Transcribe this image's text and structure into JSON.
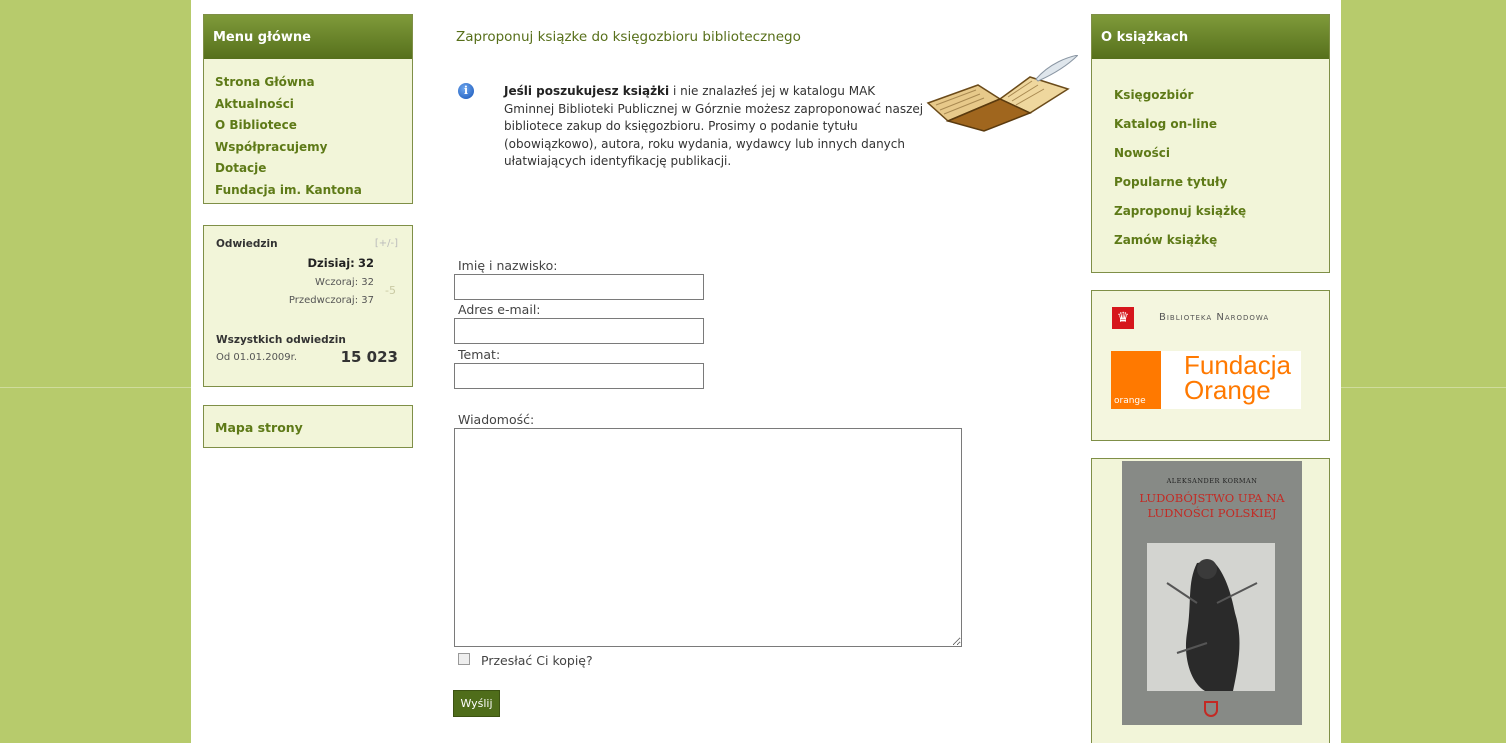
{
  "left": {
    "menu": {
      "title": "Menu główne",
      "items": [
        "Strona Główna",
        "Aktualności",
        "O Bibliotece",
        "Współpracujemy",
        "Dotacje",
        "Fundacja im. Kantona"
      ]
    },
    "stats": {
      "title": "Odwiedzin",
      "toggle": "[+/-]",
      "today_label": "Dzisiaj:",
      "today": "32",
      "yesterday_label": "Wczoraj:",
      "yesterday": "32",
      "before_label": "Przedwczoraj:",
      "before": "37",
      "diff": "-5",
      "total_title": "Wszystkich odwiedzin",
      "since": "Od 01.01.2009r.",
      "total": "15 023"
    },
    "sitemap": "Mapa strony"
  },
  "main": {
    "title": "Zaproponuj ksiązke do księgozbioru bibliotecznego",
    "info_bold": "Jeśli poszukujesz książki",
    "info_rest": " i nie znalazłeś jej w katalogu MAK Gminnej Biblioteki Publicznej w Górznie możesz zaproponować naszej bibliotece zakup do księgozbioru. Prosimy o podanie tytułu (obowiązkowo), autora, roku wydania, wydawcy lub innych danych ułatwiających identyfikację publikacji.",
    "form": {
      "name_label": "Imię i nazwisko:",
      "email_label": "Adres e-mail:",
      "subject_label": "Temat:",
      "message_label": "Wiadomość:",
      "copy_label": "Przesłać Ci kopię?",
      "send_label": "Wyślij",
      "name_value": "",
      "email_value": "",
      "subject_value": ""
    }
  },
  "right": {
    "about": {
      "title": "O książkach",
      "items": [
        "Księgozbiór",
        "Katalog on-line",
        "Nowości",
        "Popularne tytuły",
        "Zaproponuj książkę",
        "Zamów książkę"
      ]
    },
    "logos": {
      "bn": "Biblioteka Narodowa",
      "orange_small": "orange",
      "orange_line1": "Fundacja",
      "orange_line2": "Orange"
    },
    "cover": {
      "author": "ALEKSANDER KORMAN",
      "title": "LUDOBÓJSTWO UPA NA LUDNOŚCI POLSKIEJ"
    }
  },
  "colors": {
    "background": "#b7cb6c",
    "accent": "#5e7a17",
    "header_gradient_top": "#7f9a3a",
    "header_gradient_bottom": "#56701c"
  }
}
